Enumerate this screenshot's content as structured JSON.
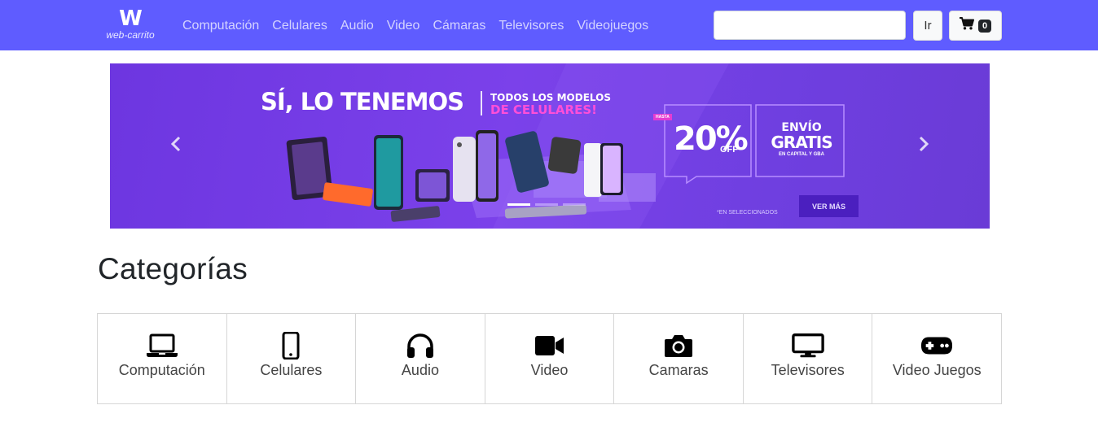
{
  "brand": {
    "logo_letter": "W",
    "logo_text": "web-carrito"
  },
  "nav": {
    "links": [
      {
        "label": "Computación"
      },
      {
        "label": "Celulares"
      },
      {
        "label": "Audio"
      },
      {
        "label": "Video"
      },
      {
        "label": "Cámaras"
      },
      {
        "label": "Televisores"
      },
      {
        "label": "Videojuegos"
      }
    ]
  },
  "search": {
    "value": "",
    "placeholder": "",
    "button_label": "Ir"
  },
  "cart": {
    "count": "0",
    "icon": "cart-icon"
  },
  "banner": {
    "headline": "SÍ, LO TENEMOS",
    "subline1": "TODOS LOS MODELOS",
    "subline2": "DE CELULARES!",
    "hasta": "HASTA",
    "discount": "20%",
    "off": "OFF",
    "envio": "ENVÍO",
    "gratis": "GRATIS",
    "envio_note": "EN CAPITAL Y GBA",
    "fine_print": "*EN SELECCIONADOS",
    "cta": "VER MÁS",
    "slides": 3,
    "active_slide": 1
  },
  "categories": {
    "title": "Categorías",
    "items": [
      {
        "label": "Computación",
        "icon": "laptop-icon"
      },
      {
        "label": "Celulares",
        "icon": "mobile-phone-icon"
      },
      {
        "label": "Audio",
        "icon": "headphones-icon"
      },
      {
        "label": "Video",
        "icon": "video-camera-icon"
      },
      {
        "label": "Camaras",
        "icon": "camera-icon"
      },
      {
        "label": "Televisores",
        "icon": "television-icon"
      },
      {
        "label": "Video Juegos",
        "icon": "gamepad-icon"
      }
    ]
  },
  "colors": {
    "navbar": "#5f5cff",
    "banner": "#7b41ea",
    "accent_pink": "#ff4fd8"
  }
}
